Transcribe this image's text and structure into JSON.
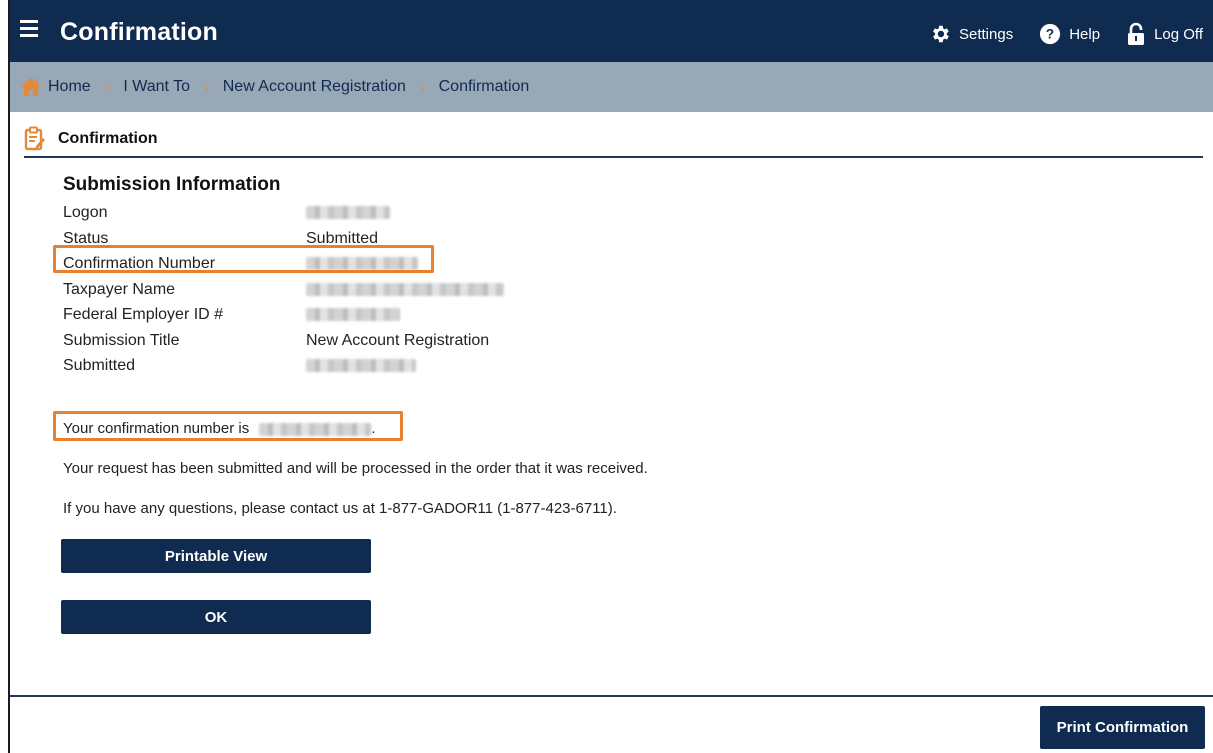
{
  "header": {
    "title": "Confirmation",
    "links": {
      "settings": "Settings",
      "help": "Help",
      "logoff": "Log Off"
    }
  },
  "breadcrumb": [
    "Home",
    "I Want To",
    "New Account Registration",
    "Confirmation"
  ],
  "section": {
    "title": "Confirmation"
  },
  "submission": {
    "heading": "Submission Information",
    "rows": [
      {
        "label": "Logon",
        "value": ""
      },
      {
        "label": "Status",
        "value": "Submitted"
      },
      {
        "label": "Confirmation Number",
        "value": ""
      },
      {
        "label": "Taxpayer Name",
        "value": ""
      },
      {
        "label": "Federal Employer ID #",
        "value": ""
      },
      {
        "label": "Submission Title",
        "value": "New Account Registration"
      },
      {
        "label": "Submitted",
        "value": ""
      }
    ]
  },
  "messages": {
    "confirmation_prefix": "Your confirmation number is",
    "confirmation_suffix": ".",
    "processed": "Your request has been submitted and will be processed in the order that it was received.",
    "contact": "If you have any questions, please contact us at 1-877-GADOR11 (1-877-423-6711)."
  },
  "buttons": {
    "printable_view": "Printable View",
    "ok": "OK",
    "print_confirmation": "Print Confirmation"
  },
  "colors": {
    "navy": "#0f2b4f",
    "breadcrumb_bg": "#99a8b6",
    "highlight": "#e8802f"
  }
}
